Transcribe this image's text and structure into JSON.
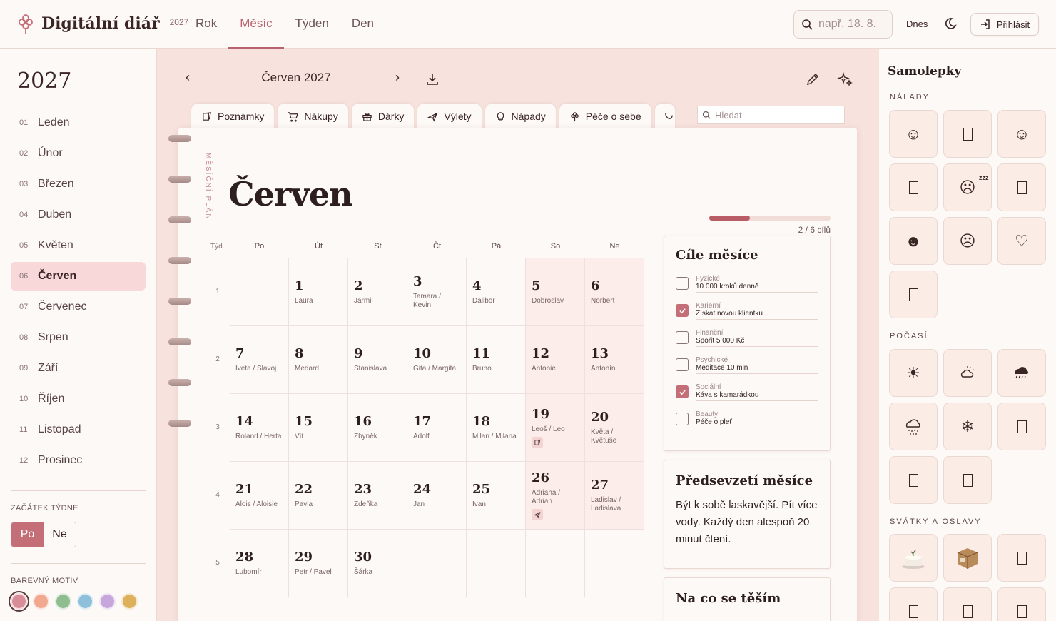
{
  "app": {
    "title": "Digitální diář",
    "year": "2027"
  },
  "nav": {
    "tabs": [
      "Rok",
      "Měsíc",
      "Týden",
      "Den"
    ],
    "active": 1
  },
  "search": {
    "placeholder": "např. 18. 8."
  },
  "header": {
    "today": "Dnes",
    "login": "Přihlásit"
  },
  "sidebar": {
    "year": "2027",
    "months": [
      {
        "num": "01",
        "name": "Leden"
      },
      {
        "num": "02",
        "name": "Únor"
      },
      {
        "num": "03",
        "name": "Březen"
      },
      {
        "num": "04",
        "name": "Duben"
      },
      {
        "num": "05",
        "name": "Květen"
      },
      {
        "num": "06",
        "name": "Červen"
      },
      {
        "num": "07",
        "name": "Červenec"
      },
      {
        "num": "08",
        "name": "Srpen"
      },
      {
        "num": "09",
        "name": "Září"
      },
      {
        "num": "10",
        "name": "Říjen"
      },
      {
        "num": "11",
        "name": "Listopad"
      },
      {
        "num": "12",
        "name": "Prosinec"
      }
    ],
    "active_month": 5,
    "week_start_label": "ZAČÁTEK TÝDNE",
    "week_start_options": [
      "Po",
      "Ne"
    ],
    "color_theme_label": "BAREVNÝ MOTIV",
    "theme_colors": [
      "#d98d98",
      "#f2a88f",
      "#8fbd8f",
      "#8ec0dc",
      "#c7a6dc",
      "#ddb15c"
    ]
  },
  "month_nav": {
    "label": "Červen 2027"
  },
  "tabs": [
    {
      "label": "Poznámky",
      "icon": "note-icon"
    },
    {
      "label": "Nákupy",
      "icon": "cart-icon"
    },
    {
      "label": "Dárky",
      "icon": "gift-icon"
    },
    {
      "label": "Výlety",
      "icon": "plane-icon"
    },
    {
      "label": "Nápady",
      "icon": "bulb-icon"
    },
    {
      "label": "Péče o sebe",
      "icon": "flower-icon"
    }
  ],
  "tab_search": {
    "placeholder": "Hledat"
  },
  "page": {
    "vertical_label": "MĚSÍČNÍ PLÁN",
    "month_title": "Červen",
    "progress": {
      "done": 2,
      "total": 6,
      "text": "2 / 6 cílů"
    }
  },
  "calendar": {
    "week_label": "Týd.",
    "day_names": [
      "Po",
      "Út",
      "St",
      "Čt",
      "Pá",
      "So",
      "Ne"
    ],
    "weeks": [
      {
        "num": "1",
        "days": [
          null,
          {
            "d": "1",
            "n": "Laura"
          },
          {
            "d": "2",
            "n": "Jarmil"
          },
          {
            "d": "3",
            "n": "Tamara / Kevin"
          },
          {
            "d": "4",
            "n": "Dalibor"
          },
          {
            "d": "5",
            "n": "Dobroslav"
          },
          {
            "d": "6",
            "n": "Norbert"
          }
        ]
      },
      {
        "num": "2",
        "days": [
          {
            "d": "7",
            "n": "Iveta / Slavoj"
          },
          {
            "d": "8",
            "n": "Medard"
          },
          {
            "d": "9",
            "n": "Stanislava"
          },
          {
            "d": "10",
            "n": "Gita / Margita"
          },
          {
            "d": "11",
            "n": "Bruno"
          },
          {
            "d": "12",
            "n": "Antonie"
          },
          {
            "d": "13",
            "n": "Antonín"
          }
        ]
      },
      {
        "num": "3",
        "days": [
          {
            "d": "14",
            "n": "Roland / Herta"
          },
          {
            "d": "15",
            "n": "Vít"
          },
          {
            "d": "16",
            "n": "Zbyněk"
          },
          {
            "d": "17",
            "n": "Adolf"
          },
          {
            "d": "18",
            "n": "Milan / Milana"
          },
          {
            "d": "19",
            "n": "Leoš / Leo",
            "icon": "note-icon"
          },
          {
            "d": "20",
            "n": "Květa / Květuše"
          }
        ]
      },
      {
        "num": "4",
        "days": [
          {
            "d": "21",
            "n": "Alois / Aloisie"
          },
          {
            "d": "22",
            "n": "Pavla"
          },
          {
            "d": "23",
            "n": "Zdeňka"
          },
          {
            "d": "24",
            "n": "Jan"
          },
          {
            "d": "25",
            "n": "Ivan"
          },
          {
            "d": "26",
            "n": "Adriana / Adrian",
            "icon": "plane-icon"
          },
          {
            "d": "27",
            "n": "Ladislav / Ladislava"
          }
        ]
      },
      {
        "num": "5",
        "days": [
          {
            "d": "28",
            "n": "Lubomír"
          },
          {
            "d": "29",
            "n": "Petr / Pavel"
          },
          {
            "d": "30",
            "n": "Šárka"
          },
          null,
          null,
          null,
          null
        ]
      }
    ]
  },
  "goals": {
    "title": "Cíle měsíce",
    "items": [
      {
        "cat": "Fyzické",
        "val": "10 000 kroků denně",
        "done": false
      },
      {
        "cat": "Kariérní",
        "val": "Získat novou klientku",
        "done": true
      },
      {
        "cat": "Finanční",
        "val": "Spořit 5 000 Kč",
        "done": false
      },
      {
        "cat": "Psychické",
        "val": "Meditace 10 min",
        "done": false
      },
      {
        "cat": "Sociální",
        "val": "Káva s kamarádkou",
        "done": true
      },
      {
        "cat": "Beauty",
        "val": "Péče o pleť",
        "done": false
      }
    ]
  },
  "resolution": {
    "title": "Předsevzetí měsíce",
    "text": "Být k sobě laskavější. Pít více vody. Každý den alespoň 20 minut čtení."
  },
  "looking_forward": {
    "title": "Na co se těším"
  },
  "stickers": {
    "title": "Samolepky",
    "moods_label": "NÁLADY",
    "moods": [
      "☺",
      "",
      "☺",
      "",
      "zzz",
      "",
      "☻",
      "☹",
      "♡",
      ""
    ],
    "weather_label": "POČASÍ",
    "weather": [
      "☀",
      "sun-cloud",
      "rain",
      "snow-cloud",
      "❄",
      "",
      "",
      ""
    ],
    "holidays_label": "SVÁTKY A OSLAVY",
    "holidays": [
      "cake",
      "package",
      "",
      "",
      "",
      ""
    ]
  }
}
